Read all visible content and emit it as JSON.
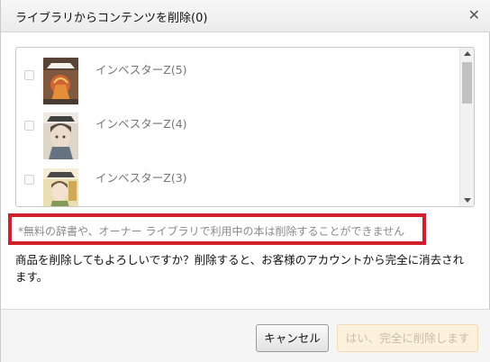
{
  "dialog": {
    "title": "ライブラリからコンテンツを削除(0)",
    "close_icon": "close-icon"
  },
  "items": [
    {
      "title": "インベスターZ(5)",
      "checked": false
    },
    {
      "title": "インベスターZ(4)",
      "checked": false
    },
    {
      "title": "インベスターZ(3)",
      "checked": false
    }
  ],
  "notice": "*無料の辞書や、オーナー ライブラリで利用中の本は削除することができません",
  "message": "商品を削除してもよろしいですか？削除すると、お客様のアカウントから完全に消去されます。",
  "buttons": {
    "cancel": "キャンセル",
    "confirm": "はい、完全に削除します"
  },
  "colors": {
    "notice_border": "#d21f2c",
    "confirm_bg": "#fbf1dc"
  }
}
